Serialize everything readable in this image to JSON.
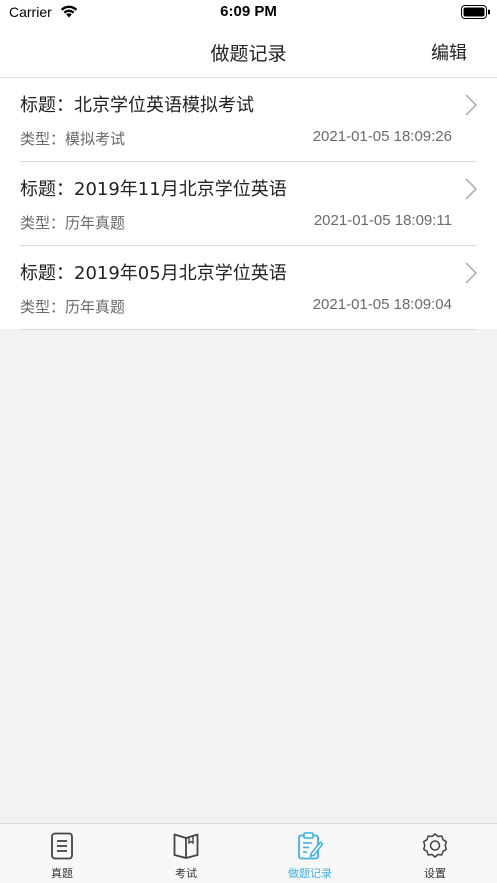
{
  "status_bar": {
    "carrier": "Carrier",
    "time": "6:09 PM"
  },
  "nav": {
    "title": "做题记录",
    "edit_label": "编辑"
  },
  "records": [
    {
      "title": "标题：北京学位英语模拟考试",
      "type": "类型：模拟考试",
      "date": "2021-01-05 18:09:26"
    },
    {
      "title": "标题：2019年11月北京学位英语",
      "type": "类型：历年真题",
      "date": "2021-01-05 18:09:11"
    },
    {
      "title": "标题：2019年05月北京学位英语",
      "type": "类型：历年真题",
      "date": "2021-01-05 18:09:04"
    }
  ],
  "tabs": [
    {
      "label": "真题",
      "icon": "document-icon",
      "active": false
    },
    {
      "label": "考试",
      "icon": "book-icon",
      "active": false
    },
    {
      "label": "做题记录",
      "icon": "clipboard-edit-icon",
      "active": true
    },
    {
      "label": "设置",
      "icon": "gear-icon",
      "active": false
    }
  ],
  "colors": {
    "accent": "#3eb0e8",
    "background": "#f2f2f2",
    "tab_inactive": "#444444"
  }
}
